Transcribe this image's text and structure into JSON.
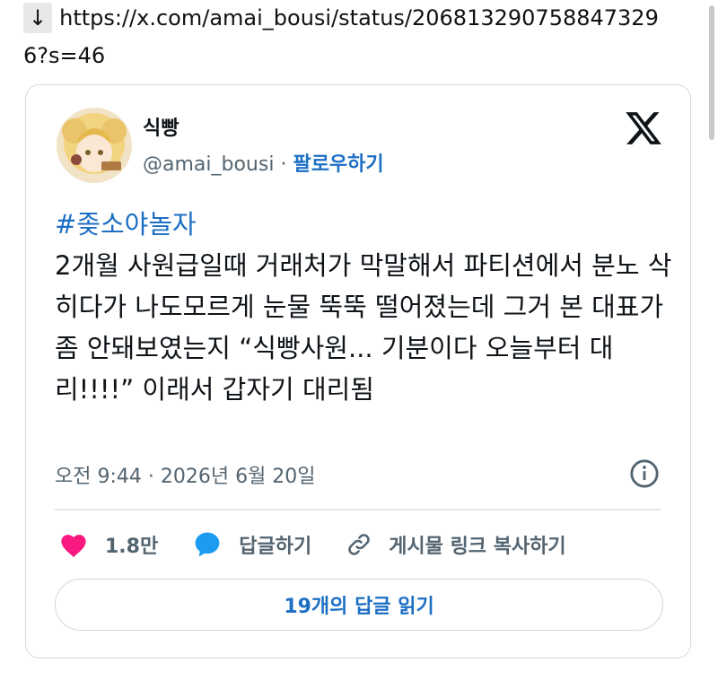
{
  "url": {
    "arrow": "↓",
    "line1": "https://x.com/amai_bousi/status/206813290758847329",
    "line2": "6?s=46"
  },
  "tweet": {
    "display_name": "식빵",
    "handle": "@amai_bousi",
    "separator": "·",
    "follow_label": "팔로우하기",
    "hashtag": "#좆소야놀자",
    "text": "2개월 사원급일때 거래처가 막말해서 파티션에서 분노 삭히다가 나도모르게 눈물 뚝뚝 떨어졌는데 그거 본 대표가 좀 안돼보였는지 “식빵사원... 기분이다 오늘부터 대리!!!!” 이래서 갑자기 대리됨",
    "timestamp": "오전 9:44 · 2026년 6월 20일",
    "likes": "1.8만",
    "reply_label": "답글하기",
    "copy_link_label": "게시물 링크 복사하기",
    "read_replies_label": "19개의 답글 읽기"
  },
  "colors": {
    "accent": "#1d6fc4",
    "heart": "#f91880",
    "reply": "#1d9bf0",
    "muted": "#536471"
  },
  "icons": [
    "x-logo-icon",
    "info-icon",
    "heart-icon",
    "reply-bubble-icon",
    "link-icon",
    "avatar-image"
  ]
}
